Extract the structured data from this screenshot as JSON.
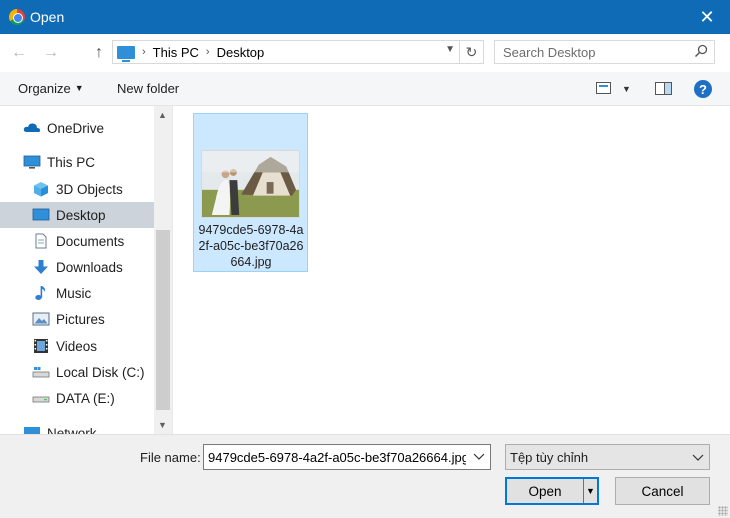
{
  "window": {
    "title": "Open",
    "close_glyph": "✕"
  },
  "nav": {
    "back_glyph": "←",
    "forward_glyph": "→",
    "up_glyph": "↑",
    "breadcrumb": [
      "This PC",
      "Desktop"
    ],
    "search_placeholder": "Search Desktop"
  },
  "toolbar": {
    "organize_label": "Organize",
    "new_folder_label": "New folder",
    "help_glyph": "?"
  },
  "sidebar": {
    "items": [
      {
        "label": "OneDrive",
        "icon": "cloud-icon"
      },
      {
        "label": "This PC",
        "icon": "computer-icon"
      },
      {
        "label": "3D Objects",
        "icon": "cube-icon"
      },
      {
        "label": "Desktop",
        "icon": "desktop-icon",
        "selected": true
      },
      {
        "label": "Documents",
        "icon": "document-icon"
      },
      {
        "label": "Downloads",
        "icon": "download-arrow-icon"
      },
      {
        "label": "Music",
        "icon": "music-note-icon"
      },
      {
        "label": "Pictures",
        "icon": "picture-icon"
      },
      {
        "label": "Videos",
        "icon": "film-icon"
      },
      {
        "label": "Local Disk (C:)",
        "icon": "drive-icon"
      },
      {
        "label": "DATA (E:)",
        "icon": "drive-icon"
      },
      {
        "label": "Network",
        "icon": "network-icon"
      }
    ]
  },
  "files": [
    {
      "name": "9479cde5-6978-4a2f-a05c-be3f70a26664.jpg"
    }
  ],
  "bottom": {
    "file_name_label": "File name:",
    "file_name_value": "9479cde5-6978-4a2f-a05c-be3f70a26664.jpg",
    "file_type_value": "Tệp tùy chỉnh",
    "open_label": "Open",
    "cancel_label": "Cancel"
  },
  "colors": {
    "titlebar": "#0f6bb5",
    "accent": "#0078d7",
    "selection": "#cce8ff"
  }
}
